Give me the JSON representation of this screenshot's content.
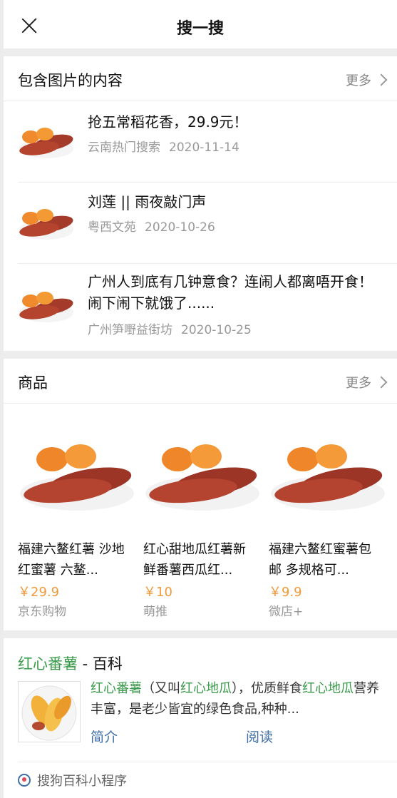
{
  "header": {
    "title": "搜一搜"
  },
  "image_section": {
    "title": "包含图片的内容",
    "more": "更多",
    "items": [
      {
        "title": "抢五常稻花香，29.9元！",
        "source": "云南热门搜索",
        "date": "2020-11-14"
      },
      {
        "title": "刘莲 || 雨夜敲门声",
        "source": "粤西文苑",
        "date": "2020-10-26"
      },
      {
        "title": "广州人到底有几钟意食？连闹人都离唔开食！闹下闹下就饿了......",
        "source": "广州笋嘢益街坊",
        "date": "2020-10-25"
      }
    ]
  },
  "goods_section": {
    "title": "商品",
    "more": "更多",
    "items": [
      {
        "name": "福建六鳌红薯 沙地红蜜薯 六鳌...",
        "price": "￥29.9",
        "shop": "京东购物"
      },
      {
        "name": "红心甜地瓜红薯新鲜番薯西瓜红...",
        "price": "￥10",
        "shop": "萌推"
      },
      {
        "name": "福建六鳌红蜜薯包邮 多规格可...",
        "price": "￥9.9",
        "shop": "微店+"
      }
    ]
  },
  "baike": {
    "keyword": "红心番薯",
    "suffix": " - 百科",
    "desc_parts": [
      "红心番薯",
      "（又叫",
      "红心地瓜",
      "），优质鲜食",
      "红心地瓜",
      "营养丰富，是老少皆宜的绿色食品,种种..."
    ],
    "link_intro": "简介",
    "link_read": "阅读",
    "source": "搜狗百科小程序"
  },
  "colors": {
    "accent_green": "#3a9a4b",
    "price_orange": "#f29a3a",
    "link_blue": "#3e6fa8"
  }
}
